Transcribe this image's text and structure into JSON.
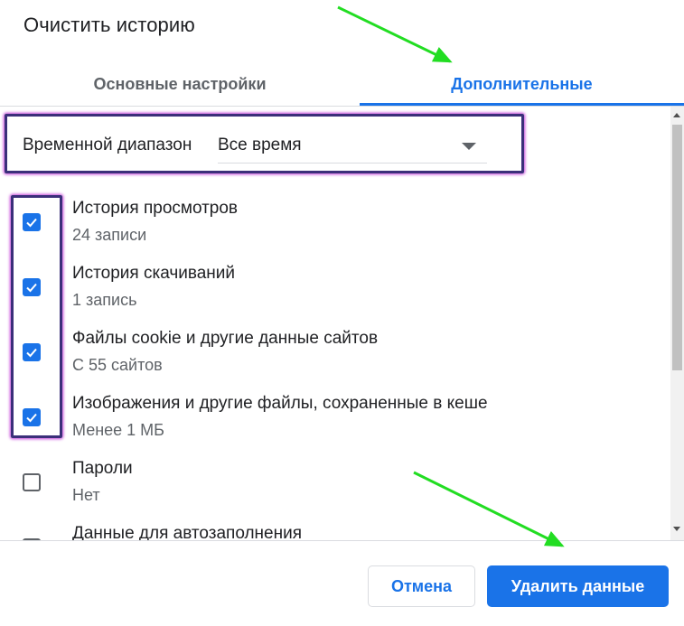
{
  "dialog": {
    "title": "Очистить историю"
  },
  "tabs": [
    {
      "label": "Основные настройки",
      "active": false
    },
    {
      "label": "Дополнительные",
      "active": true
    }
  ],
  "time_range": {
    "label": "Временной диапазон",
    "value": "Все время"
  },
  "options": [
    {
      "label": "История просмотров",
      "sub": "24 записи",
      "checked": true
    },
    {
      "label": "История скачиваний",
      "sub": "1 запись",
      "checked": true
    },
    {
      "label": "Файлы cookie и другие данные сайтов",
      "sub": "С 55 сайтов",
      "checked": true
    },
    {
      "label": "Изображения и другие файлы, сохраненные в кеше",
      "sub": "Менее 1 МБ",
      "checked": true
    },
    {
      "label": "Пароли",
      "sub": "Нет",
      "checked": false
    },
    {
      "label": "Данные для автозаполнения",
      "sub": "",
      "checked": false
    }
  ],
  "buttons": {
    "cancel": "Отмена",
    "delete": "Удалить данные"
  },
  "colors": {
    "accent": "#1a73e8",
    "annotation_arrow": "#22dd22",
    "annotation_box": "#3b2f7a"
  }
}
